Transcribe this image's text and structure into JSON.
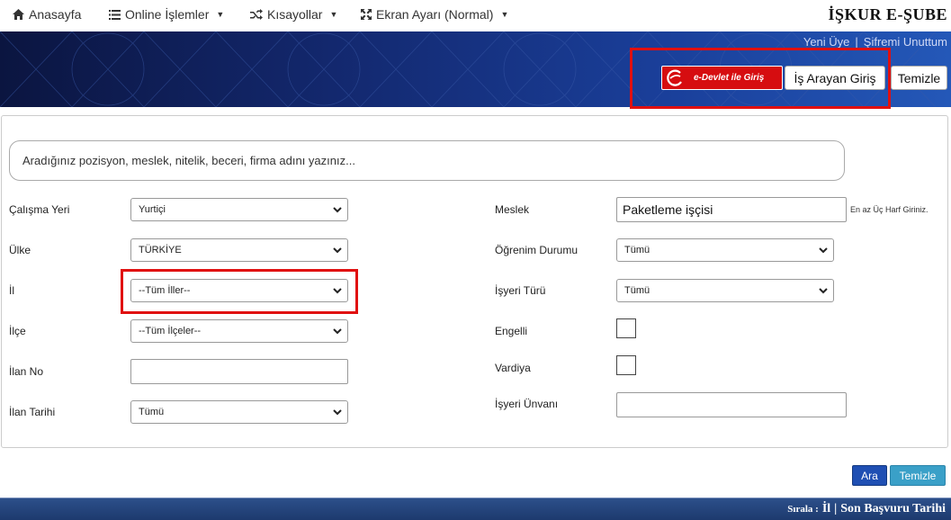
{
  "nav": {
    "home": "Anasayfa",
    "online": "Online İşlemler",
    "shortcuts": "Kısayollar",
    "screen": "Ekran Ayarı (Normal)",
    "brand": "İŞKUR E-ŞUBE"
  },
  "banner": {
    "new_member": "Yeni Üye",
    "separator": "|",
    "forgot_password": "Şifremi Unuttum",
    "edevlet_label": "e-Devlet ile Giriş",
    "job_seeker_login": "İş Arayan Giriş",
    "clear": "Temizle"
  },
  "search": {
    "placeholder": "Aradığınız pozisyon, meslek, nitelik, beceri, firma adını yazınız..."
  },
  "form_left": {
    "work_place_label": "Çalışma Yeri",
    "work_place_value": "Yurtiçi",
    "country_label": "Ülke",
    "country_value": "TÜRKİYE",
    "province_label": "İl",
    "province_value": "--Tüm İller--",
    "district_label": "İlçe",
    "district_value": "--Tüm İlçeler--",
    "ad_no_label": "İlan No",
    "ad_no_value": "",
    "ad_date_label": "İlan Tarihi",
    "ad_date_value": "Tümü"
  },
  "form_right": {
    "profession_label": "Meslek",
    "profession_value": "Paketleme işçisi",
    "profession_hint": "En az Üç Harf Giriniz.",
    "education_label": "Öğrenim Durumu",
    "education_value": "Tümü",
    "workplace_type_label": "İşyeri Türü",
    "workplace_type_value": "Tümü",
    "disabled_label": "Engelli",
    "shift_label": "Vardiya",
    "workplace_title_label": "İşyeri Ünvanı",
    "workplace_title_value": ""
  },
  "actions": {
    "search": "Ara",
    "clear": "Temizle"
  },
  "footer": {
    "sort_label": "Sırala :",
    "sort_province": "İl",
    "sort_separator": "|",
    "sort_deadline": "Son Başvuru Tarihi"
  },
  "colors": {
    "highlight_red": "#e01010",
    "edevlet_red": "#d60d10",
    "button_blue": "#1f4fb3",
    "button_teal": "#3aa0c8"
  }
}
